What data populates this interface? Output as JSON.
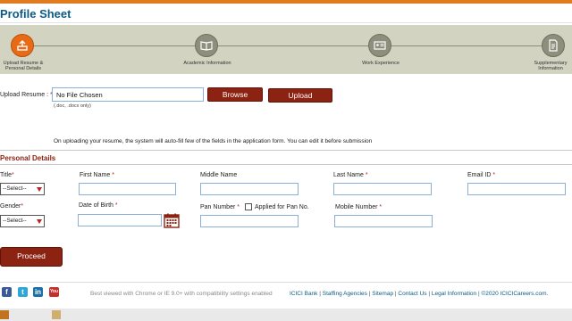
{
  "page": {
    "title": "Profile Sheet"
  },
  "steps": [
    {
      "label": "Upload Resume & Personal Details",
      "icon": "upload-icon",
      "active": true
    },
    {
      "label": "Academic Information",
      "icon": "book-icon",
      "active": false
    },
    {
      "label": "Work Experience",
      "icon": "id-card-icon",
      "active": false
    },
    {
      "label": "Supplementary Information",
      "icon": "document-icon",
      "active": false
    }
  ],
  "upload": {
    "label": "Upload Resume :",
    "required_mark": "*",
    "file_status": "No File Chosen",
    "browse_label": "Browse",
    "upload_label": "Upload",
    "hint": "(.doc, .docx only)",
    "info": "On uploading your resume, the system will auto-fill few of the fields in the application form. You can edit it before submission"
  },
  "personal": {
    "section_title": "Personal Details",
    "title_label": "Title",
    "first_name_label": "First Name",
    "middle_name_label": "Middle Name",
    "last_name_label": "Last Name",
    "email_label": "Email ID",
    "gender_label": "Gender",
    "dob_label": "Date of Birth",
    "pan_label": "Pan Number",
    "pan_applied_label": "Applied for Pan No.",
    "mobile_label": "Mobile Number",
    "select_default": "--Select--",
    "required_mark": "*"
  },
  "actions": {
    "proceed_label": "Proceed"
  },
  "footer": {
    "social": [
      "facebook-icon",
      "twitter-icon",
      "linkedin-icon",
      "youtube-icon"
    ],
    "browser_note": "Best viewed with Chrome or IE 9.0+ with compatibility settings enabled",
    "links": [
      "ICICI Bank",
      "Staffing Agencies",
      "Sitemap",
      "Contact Us",
      "Legal Information"
    ],
    "copyright": "©2020 ICICICareers.com."
  },
  "colors": {
    "accent": "#8c2211",
    "active_step": "#e86a14",
    "title_blue": "#0b5a86",
    "stepbar": "#d2d3c0"
  }
}
